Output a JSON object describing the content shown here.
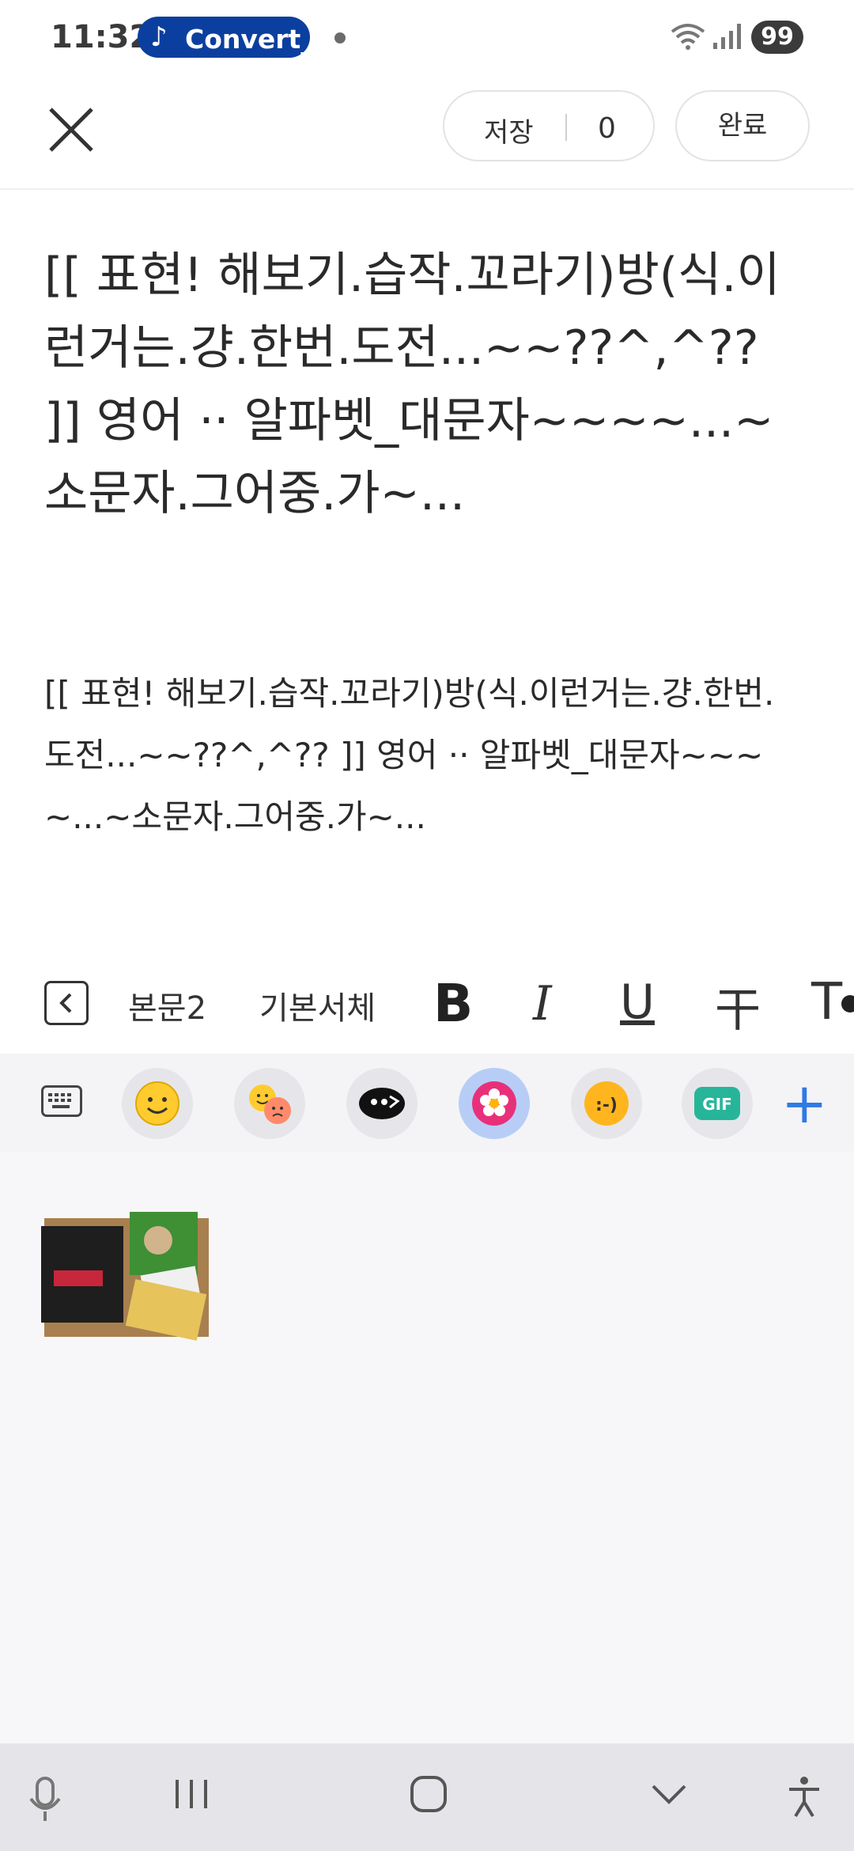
{
  "status_bar": {
    "time": "11:32",
    "app_pill_label": "Convert_",
    "music_icon": "♪",
    "battery": "99",
    "wifi_icon": "wifi-icon",
    "signal_icon": "signal-icon"
  },
  "topbar": {
    "close_icon": "close-icon",
    "save_label": "저장",
    "save_count": "0",
    "done_label": "완료"
  },
  "content": {
    "title": "[[ 표현! 해보기.습작.꼬라기)방(식.이런거는.걍.한번.도전...~~??^,^?? ]] 영어 ·· 알파벳_대문자~~~~...~소문자.그어중.가~...",
    "body": "[[ 표현! 해보기.습작.꼬라기)방(식.이런거는.걍.한번.도전...~~??^,^?? ]] 영어 ·· 알파벳_대문자~~~~...~소문자.그어중.가~..."
  },
  "format_toolbar": {
    "back_icon": "‹",
    "style_label": "본문2",
    "font_label": "기본서체",
    "bold": "B",
    "italic": "I",
    "underline": "U",
    "strike": "干",
    "text_color": "T"
  },
  "keyboard_toolbar": {
    "items": [
      "keyboard-icon",
      "emoji-icon",
      "emoji-pair-icon",
      "bitmoji-icon",
      "sticker-flower-icon",
      "text-emoticon-icon",
      "gif-icon",
      "plus-icon"
    ],
    "emoticon_text": ":-)",
    "gif_text": "GIF",
    "active_color": "#b8cdf6",
    "plus_color": "#2f7ae5"
  },
  "navbar": {
    "items": [
      "mic-icon",
      "recent-apps-icon",
      "home-icon",
      "back-down-icon",
      "accessibility-icon"
    ]
  }
}
